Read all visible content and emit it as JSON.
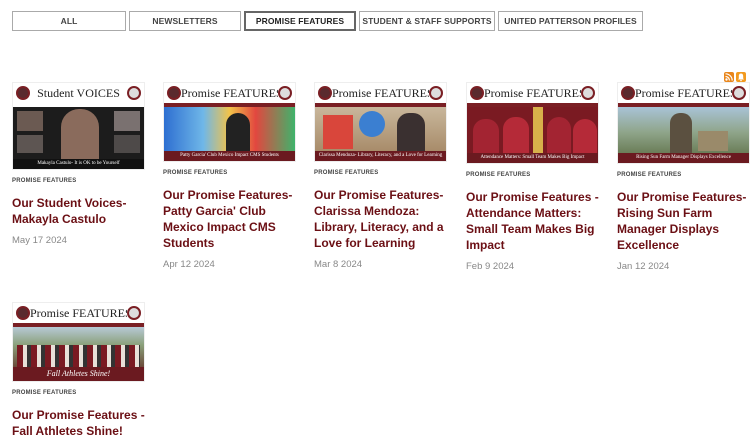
{
  "filters": [
    {
      "label": "ALL",
      "active": false
    },
    {
      "label": "NEWSLETTERS",
      "active": false
    },
    {
      "label": "PROMISE FEATURES",
      "active": true
    },
    {
      "label": "STUDENT & STAFF SUPPORTS",
      "active": false
    },
    {
      "label": "UNITED PATTERSON PROFILES",
      "active": false
    }
  ],
  "feed_icons": [
    "rss-icon",
    "notification-icon"
  ],
  "colors": {
    "brand_maroon": "#6b0f14",
    "rss_orange": "#e8861c",
    "notify_orange": "#f29a1f"
  },
  "posts": [
    {
      "thumb_banner": "Student VOICES",
      "thumb_caption": "Makayla Castulo- It is OK to be Yourself",
      "tag": "PROMISE FEATURES",
      "title": "Our Student Voices-Makayla Castulo",
      "date": "May 17 2024"
    },
    {
      "thumb_banner": "Promise FEATURES",
      "thumb_caption": "Patty Garcia' Club Mexico Impact CMS Students",
      "tag": "PROMISE FEATURES",
      "title": "Our Promise Features-Patty Garcia' Club Mexico Impact CMS Students",
      "date": "Apr 12 2024"
    },
    {
      "thumb_banner": "Promise FEATURES",
      "thumb_caption": "Clarissa Mendoza- Library, Literacy, and a Love for Learning",
      "tag": "PROMISE FEATURES",
      "title": "Our Promise Features-Clarissa Mendoza: Library, Literacy, and a Love for Learning",
      "date": "Mar 8 2024"
    },
    {
      "thumb_banner": "Promise FEATURES",
      "thumb_caption": "Attendance Matters: Small Team Makes Big Impact",
      "tag": "PROMISE FEATURES",
      "title": "Our Promise Features - Attendance Matters: Small Team Makes Big Impact",
      "date": "Feb 9 2024"
    },
    {
      "thumb_banner": "Promise FEATURES",
      "thumb_caption": "Rising Sun Farm Manager Displays Excellence",
      "tag": "PROMISE FEATURES",
      "title": "Our Promise Features-Rising Sun Farm Manager Displays Excellence",
      "date": "Jan 12 2024"
    },
    {
      "thumb_banner": "Promise FEATURES",
      "thumb_caption": "Fall Athletes Shine!",
      "tag": "PROMISE FEATURES",
      "title": "Our Promise Features - Fall Athletes Shine!",
      "date": ""
    }
  ]
}
